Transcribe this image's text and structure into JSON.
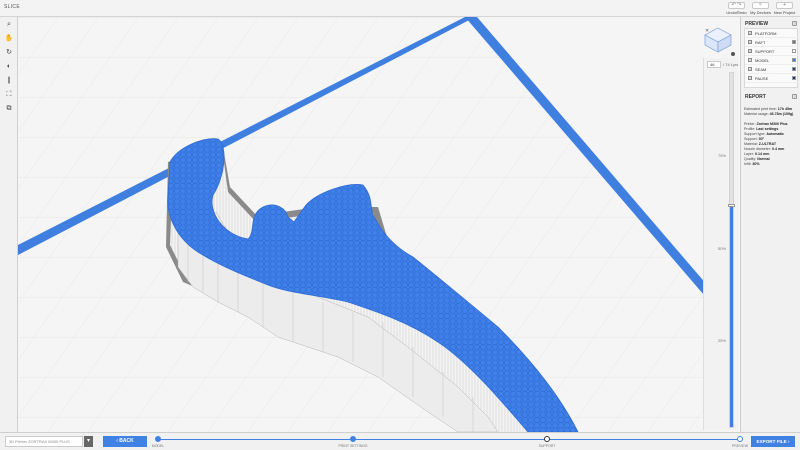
{
  "app": {
    "title": "SLICE"
  },
  "top_actions": [
    {
      "icon": "undo-redo-icon",
      "glyph": "↶ ↷",
      "label": "Undo/Redo"
    },
    {
      "icon": "wifi-icon",
      "glyph": "≈",
      "label": "My Devices"
    },
    {
      "icon": "plus-icon",
      "glyph": "+",
      "label": "New Project"
    }
  ],
  "left_tools": [
    {
      "name": "zoom-icon",
      "glyph": "⌕"
    },
    {
      "name": "pan-hand-icon",
      "glyph": "✋"
    },
    {
      "name": "rotate-icon",
      "glyph": "↻"
    },
    {
      "name": "orbit-icon",
      "glyph": "◐"
    },
    {
      "name": "pause-icon",
      "glyph": "∥"
    },
    {
      "name": "fit-view-icon",
      "glyph": "⛶"
    },
    {
      "name": "perspective-icon",
      "glyph": "⧉"
    }
  ],
  "layers": {
    "current": "46",
    "total_label": "/ 74 Lyrs",
    "fraction": 0.62,
    "markers": [
      "75%",
      "50%",
      "25%"
    ]
  },
  "preview": {
    "title": "PREVIEW",
    "items": [
      {
        "label": "PLATFORM",
        "checked": true,
        "color": ""
      },
      {
        "label": "RAFT",
        "checked": true,
        "color": "#777777"
      },
      {
        "label": "SUPPORT",
        "checked": true,
        "color": "#ffffff"
      },
      {
        "label": "MODEL",
        "checked": true,
        "color": "#3f7fe0"
      },
      {
        "label": "SEAM",
        "checked": true,
        "color": "#2b3f6b"
      },
      {
        "label": "PAUSE",
        "checked": true,
        "color": "#1f3a66"
      }
    ]
  },
  "report": {
    "title": "REPORT",
    "lines": [
      {
        "k": "Estimated print time:",
        "v": "17h 45m"
      },
      {
        "k": "Material usage:",
        "v": "46.78m (109g)"
      },
      {
        "k": "",
        "v": ""
      },
      {
        "k": "Printer:",
        "v": "Zortrax M300 Plus"
      },
      {
        "k": "Profile:",
        "v": "Last settings"
      },
      {
        "k": "Support type:",
        "v": "Automatic"
      },
      {
        "k": "Support:",
        "v": "30°"
      },
      {
        "k": "Material:",
        "v": "Z-ULTRAT"
      },
      {
        "k": "Nozzle diameter:",
        "v": "0.4 mm"
      },
      {
        "k": "Layer:",
        "v": "0.14 mm"
      },
      {
        "k": "Quality:",
        "v": "Normal"
      },
      {
        "k": "Infill:",
        "v": "30%"
      }
    ]
  },
  "bottom": {
    "printer_placeholder": "3D Printer  ZORTRAX M300 PLUS",
    "back_label": "‹  BACK",
    "export_label": "EXPORT FILE  ›",
    "steps": [
      "MODEL",
      "PRINT SETTINGS",
      "SUPPORT",
      "PREVIEW"
    ]
  }
}
